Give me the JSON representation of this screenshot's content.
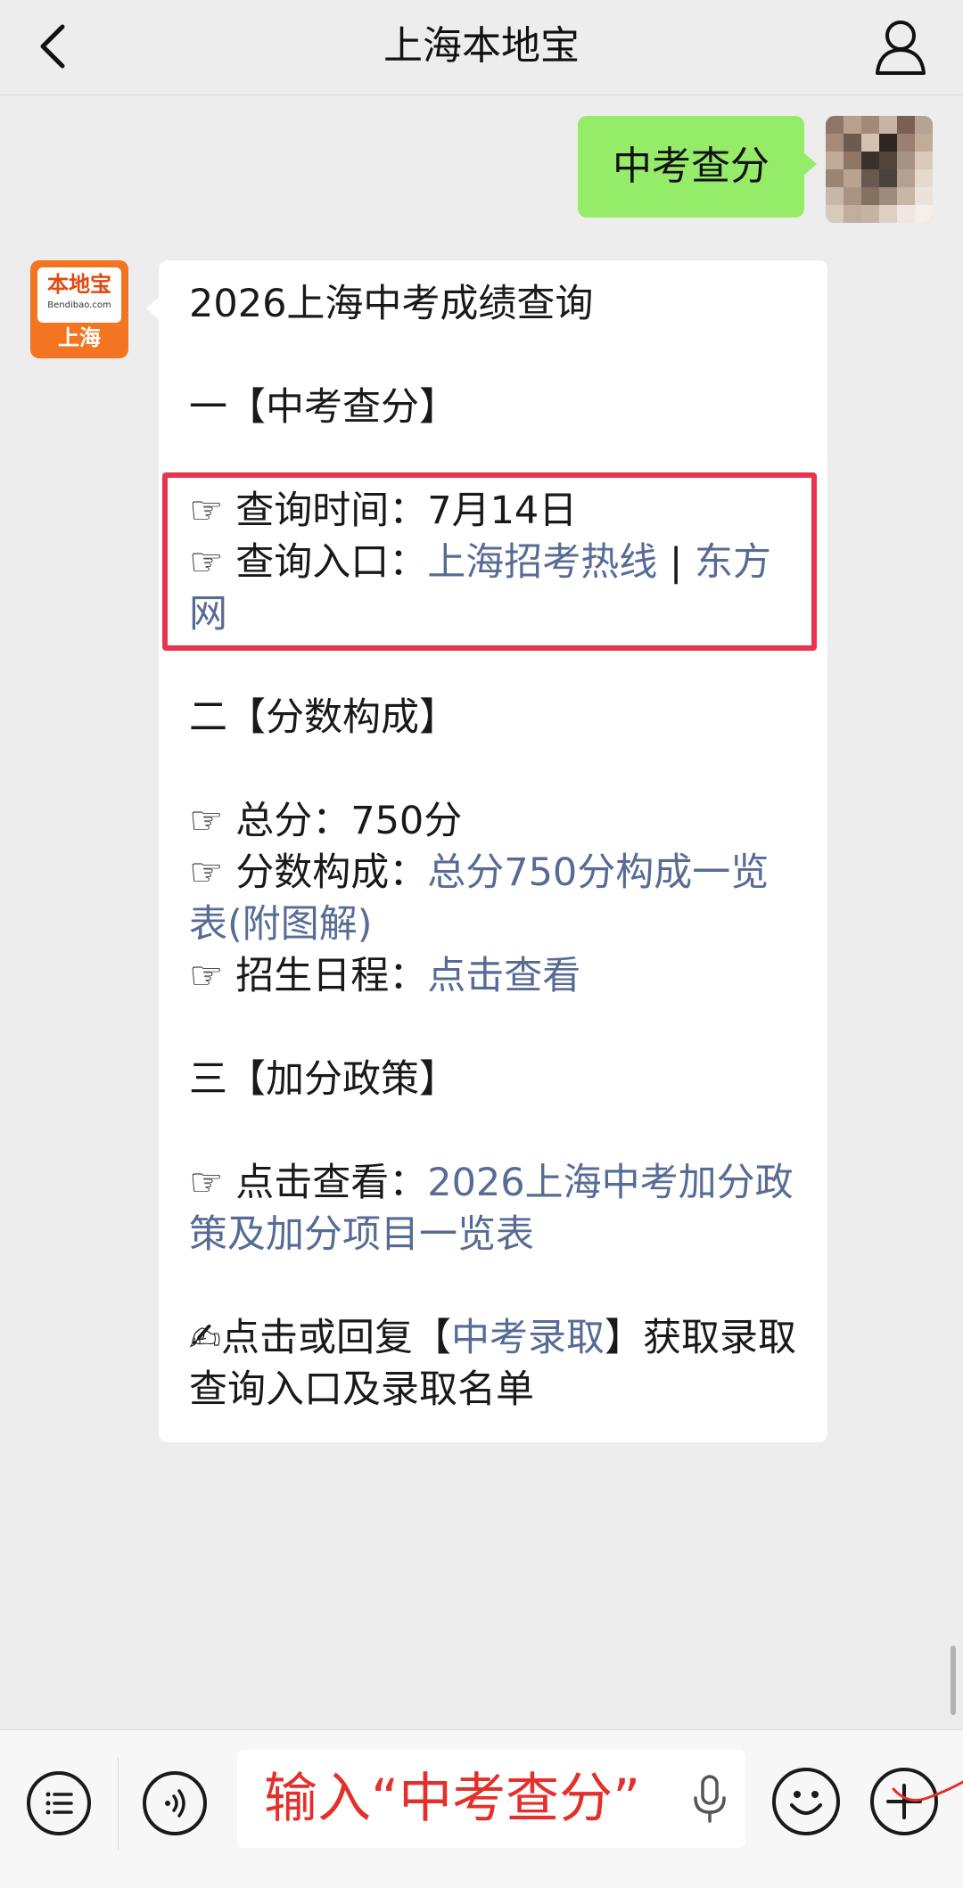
{
  "nav": {
    "title": "上海本地宝"
  },
  "chat": {
    "outgoing": {
      "text": "中考查分"
    },
    "incoming": {
      "logo": {
        "brand": "本地宝",
        "url": "Bendibao.com",
        "city": "上海"
      },
      "title": "2026上海中考成绩查询",
      "section1": {
        "heading": "一【中考查分】",
        "query_time_label": "☞ 查询时间：",
        "query_time_value": "7月14日",
        "entry_label": "☞ 查询入口：",
        "entry_link1": "上海招考热线",
        "entry_sep": " | ",
        "entry_link2": "东方网"
      },
      "section2": {
        "heading": "二【分数构成】",
        "total_label": "☞ 总分：",
        "total_value": "750分",
        "composition_label": "☞ 分数构成：",
        "composition_link": "总分750分构成一览表(附图解)",
        "schedule_label": "☞ 招生日程：",
        "schedule_link": "点击查看"
      },
      "section3": {
        "heading": "三【加分政策】",
        "bonus_label": "☞ 点击查看：",
        "bonus_link": "2026上海中考加分政策及加分项目一览表"
      },
      "footer": {
        "prefix": "✍点击或回复【",
        "keyword": "中考录取",
        "suffix": "】获取录取查询入口及录取名单"
      }
    }
  },
  "input_bar": {
    "text": "输入“中考查分”"
  },
  "colors": {
    "link": "#576b95",
    "bubble_out": "#95ec69",
    "highlight_border": "#e8344e",
    "input_text": "#e4302b"
  }
}
